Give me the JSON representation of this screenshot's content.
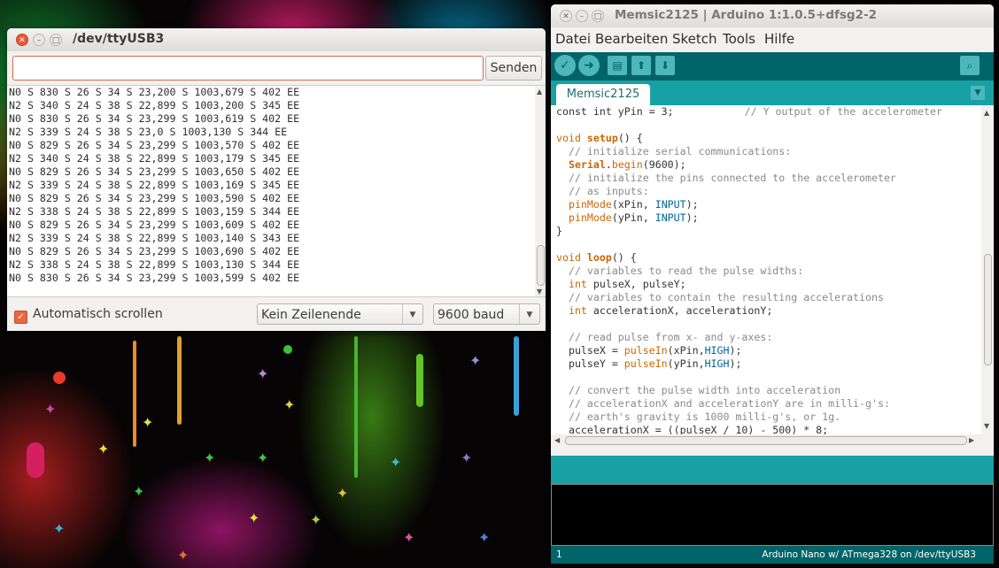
{
  "desktop": {
    "wallpaper": "colorful paint splashes with butterflies"
  },
  "serial_monitor": {
    "title": "/dev/ttyUSB3",
    "input_value": "",
    "send_label": "Senden",
    "output_lines": [
      "N0 S 830 S 26 S 34 S 23,200 S 1003,679 S 402 EE",
      "N2 S 340 S 24 S 38 S 22,899 S 1003,200 S 345 EE",
      "N0 S 830 S 26 S 34 S 23,299 S 1003,619 S 402 EE",
      "N2 S 339 S 24 S 38 S 23,0 S 1003,130 S 344 EE",
      "N0 S 829 S 26 S 34 S 23,299 S 1003,570 S 402 EE",
      "N2 S 340 S 24 S 38 S 22,899 S 1003,179 S 345 EE",
      "N0 S 829 S 26 S 34 S 23,299 S 1003,650 S 402 EE",
      "N2 S 339 S 24 S 38 S 22,899 S 1003,169 S 345 EE",
      "N0 S 829 S 26 S 34 S 23,299 S 1003,590 S 402 EE",
      "N2 S 338 S 24 S 38 S 22,899 S 1003,159 S 344 EE",
      "N0 S 829 S 26 S 34 S 23,299 S 1003,609 S 402 EE",
      "N2 S 339 S 24 S 38 S 22,899 S 1003,140 S 343 EE",
      "N0 S 829 S 26 S 34 S 23,299 S 1003,690 S 402 EE",
      "N2 S 338 S 24 S 38 S 22,899 S 1003,130 S 344 EE",
      "N0 S 830 S 26 S 34 S 23,299 S 1003,599 S 402 EE"
    ],
    "autoscroll_label": "Automatisch scrollen",
    "autoscroll_checked": true,
    "line_ending": "Kein Zeilenende",
    "baud": "9600 baud"
  },
  "ide": {
    "title": "Memsic2125 | Arduino 1:1.0.5+dfsg2-2",
    "menu": [
      "Datei",
      "Bearbeiten",
      "Sketch",
      "Tools",
      "Hilfe"
    ],
    "toolbar": {
      "verify_icon": "check-icon",
      "upload_icon": "arrow-right-icon",
      "new_icon": "file-icon",
      "open_icon": "arrow-up-icon",
      "save_icon": "arrow-down-icon",
      "monitor_icon": "magnifier-icon"
    },
    "tab": "Memsic2125",
    "code": {
      "l1a": "const int yPin = 3;",
      "l1b": "// Y output of the accelerometer",
      "l3a": "void",
      "l3b": "setup",
      "l3c": "() {",
      "l4": "// initialize serial communications:",
      "l5a": "Serial",
      "l5b": ".",
      "l5c": "begin",
      "l5d": "(9600);",
      "l6": "// initialize the pins connected to the accelerometer",
      "l7": "// as inputs:",
      "l8a": "pinMode",
      "l8b": "(xPin, ",
      "l8c": "INPUT",
      "l8d": ");",
      "l9a": "pinMode",
      "l9b": "(yPin, ",
      "l9c": "INPUT",
      "l9d": ");",
      "l10": "}",
      "l12a": "void",
      "l12b": "loop",
      "l12c": "() {",
      "l13": "// variables to read the pulse widths:",
      "l14a": "int",
      "l14b": " pulseX, pulseY;",
      "l15": "// variables to contain the resulting accelerations",
      "l16a": "int",
      "l16b": " accelerationX, accelerationY;",
      "l18": "// read pulse from x- and y-axes:",
      "l19a": "pulseX = ",
      "l19b": "pulseIn",
      "l19c": "(xPin,",
      "l19d": "HIGH",
      "l19e": ");",
      "l20a": "pulseY = ",
      "l20b": "pulseIn",
      "l20c": "(yPin,",
      "l20d": "HIGH",
      "l20e": ");",
      "l22": "// convert the pulse width into acceleration",
      "l23": "// accelerationX and accelerationY are in milli-g's:",
      "l24": "// earth's gravity is 1000 milli-g's, or 1g.",
      "l25": "accelerationX = ((pulseX / 10) - 500) * 8;"
    },
    "status_line": "1",
    "status_board": "Arduino Nano w/ ATmega328 on /dev/ttyUSB3"
  },
  "colors": {
    "arduino_teal_dark": "#006468",
    "arduino_teal": "#17a1a5",
    "ubuntu_orange": "#e8593a"
  }
}
